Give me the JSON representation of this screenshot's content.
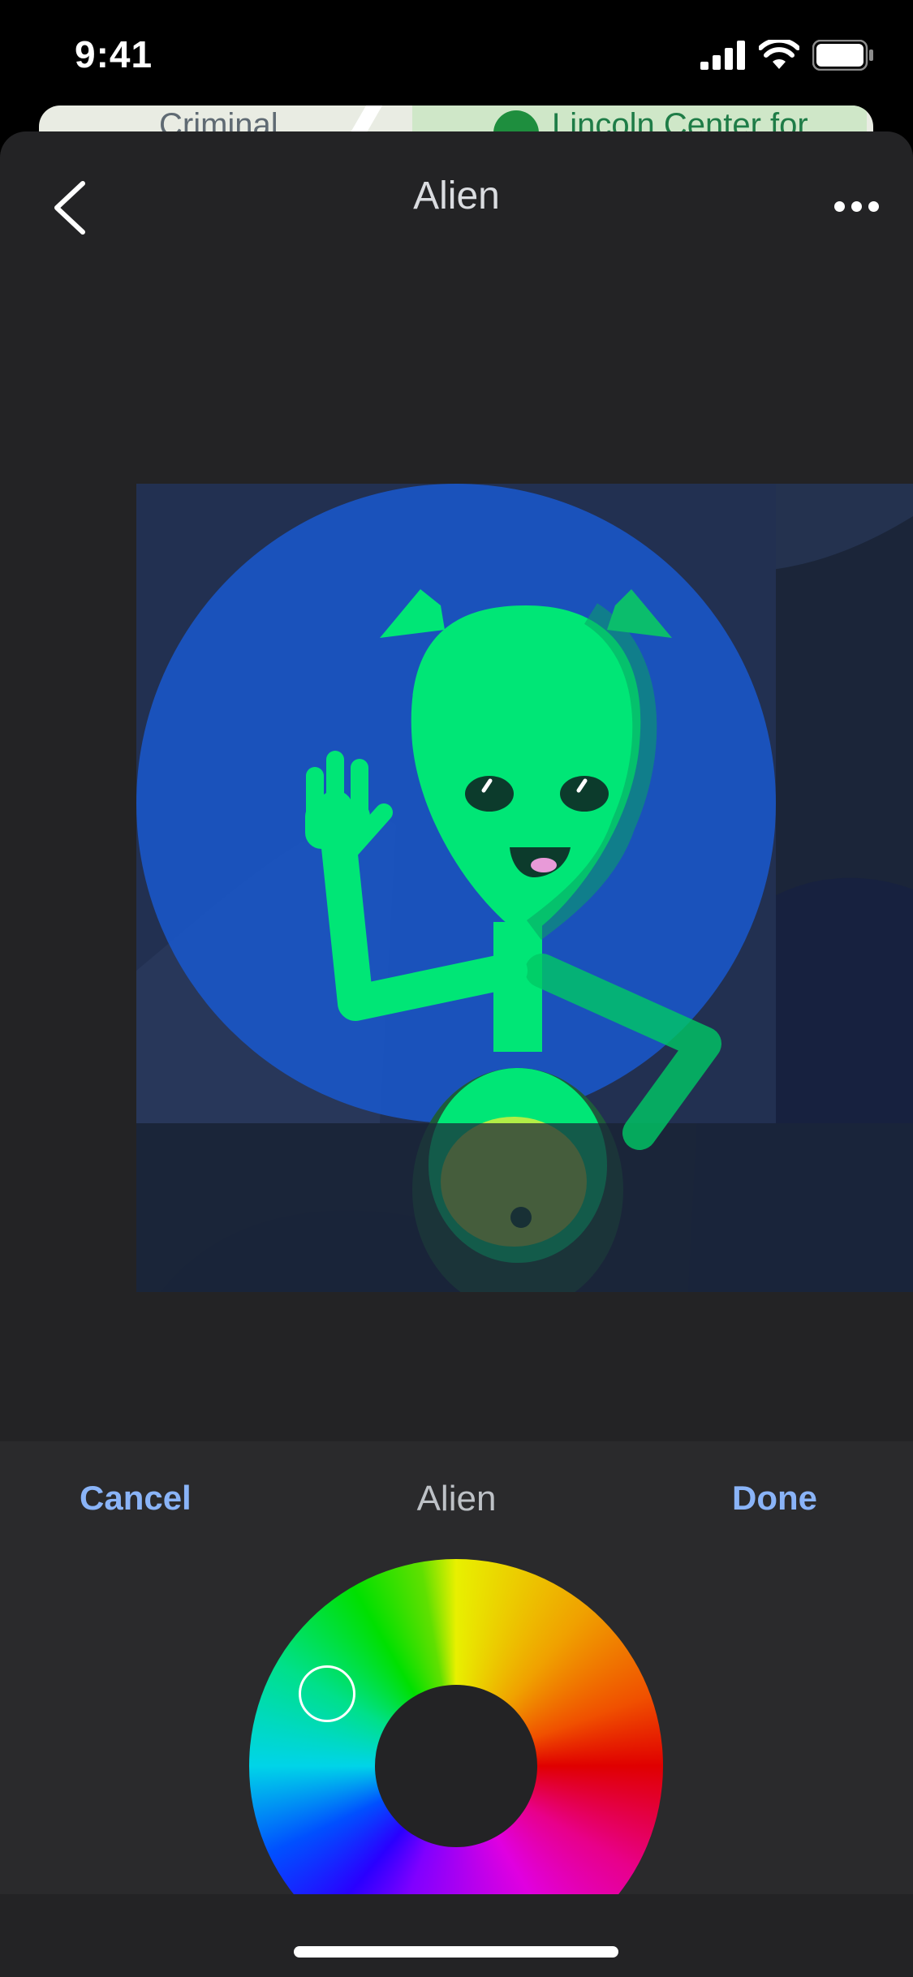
{
  "status_bar": {
    "time": "9:41"
  },
  "map_peek": {
    "left_label": "Criminal",
    "right_label": "Lincoln Center for"
  },
  "header": {
    "title": "Alien"
  },
  "picker": {
    "cancel_label": "Cancel",
    "title": "Alien",
    "done_label": "Done"
  },
  "colors": {
    "accent": "#8ab4f8",
    "sheet_background": "#232325",
    "picker_background": "#2a2a2c",
    "alien_green": "#00e676",
    "circle_blue": "#1a56c4"
  },
  "icons": [
    "chevron-left-icon",
    "more-horizontal-icon",
    "signal-icon",
    "wifi-icon",
    "battery-icon"
  ]
}
